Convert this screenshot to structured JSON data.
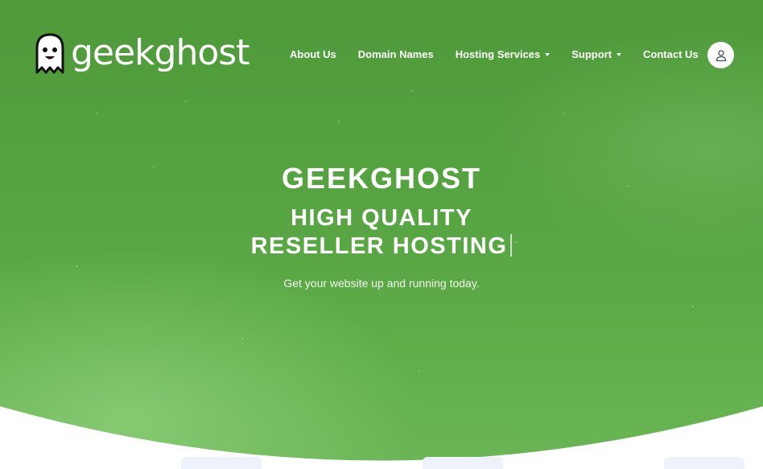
{
  "brand": {
    "logo_text": "geekghost",
    "logo_icon": "ghost-icon"
  },
  "nav": {
    "items": [
      {
        "label": "About Us",
        "dropdown": false
      },
      {
        "label": "Domain Names",
        "dropdown": false
      },
      {
        "label": "Hosting Services",
        "dropdown": true
      },
      {
        "label": "Support",
        "dropdown": true
      },
      {
        "label": "Contact Us",
        "dropdown": false
      }
    ],
    "account_icon": "user-icon"
  },
  "hero": {
    "title": "GEEKGHOST",
    "tagline_line1": "HIGH QUALITY",
    "tagline_line2": "RESELLER HOSTING",
    "subtitle": "Get your website up and running today."
  },
  "colors": {
    "hero_green": "#56a442",
    "text": "#ffffff",
    "ghost_cheek": "#ff4f9a"
  }
}
